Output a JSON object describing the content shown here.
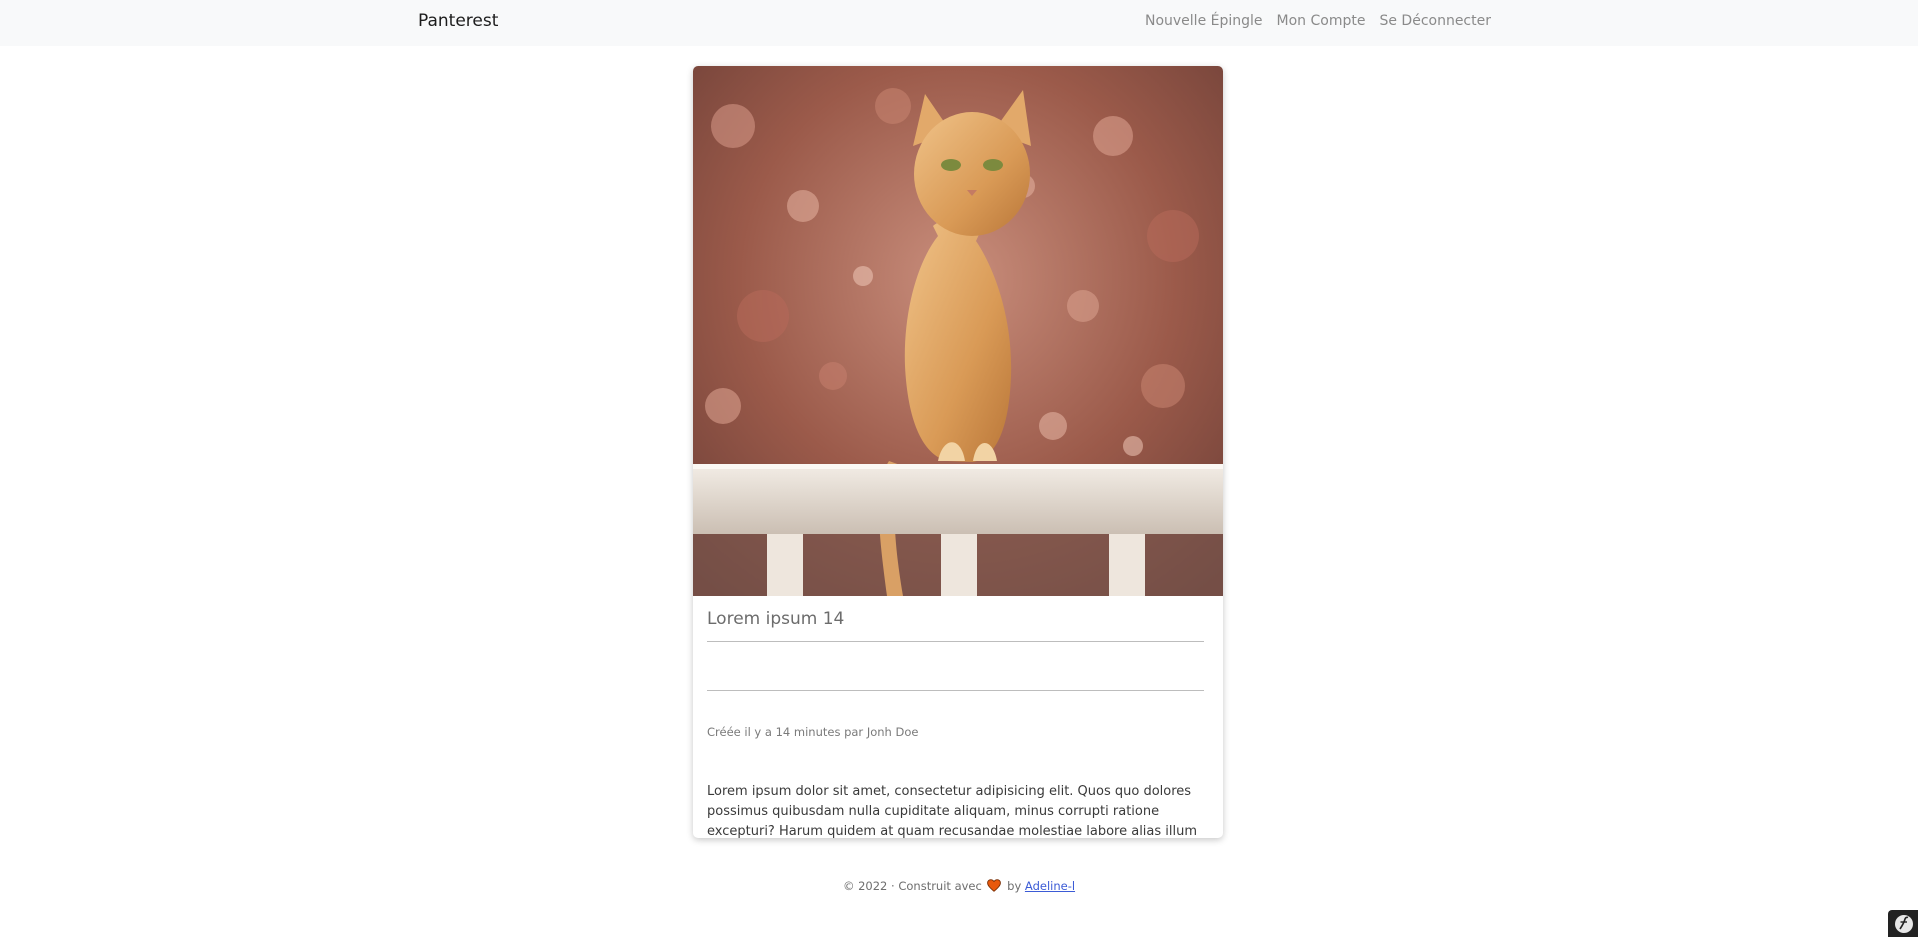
{
  "nav": {
    "brand": "Panterest",
    "links": [
      "Nouvelle Épingle",
      "Mon Compte",
      "Se Déconnecter"
    ]
  },
  "pin": {
    "image_alt": "Chat roux assis sur une balustrade",
    "title": "Lorem ipsum 14",
    "meta": "Créée il y a 14 minutes par Jonh Doe",
    "description": "Lorem ipsum dolor sit amet, consectetur adipisicing elit. Quos quo dolores possimus quibusdam nulla cupiditate aliquam, minus corrupti ratione excepturi? Harum quidem at quam recusandae molestiae labore alias illum ad."
  },
  "footer": {
    "prefix": "© 2022 · Construit avec",
    "by": "by",
    "author": "Adeline-l"
  },
  "colors": {
    "navbar_bg": "#f8f9fa",
    "link": "#3b5bd6",
    "heart": "#e8590c"
  },
  "icons": {
    "heart": "heart-icon",
    "toolbar": "symfony-icon"
  }
}
